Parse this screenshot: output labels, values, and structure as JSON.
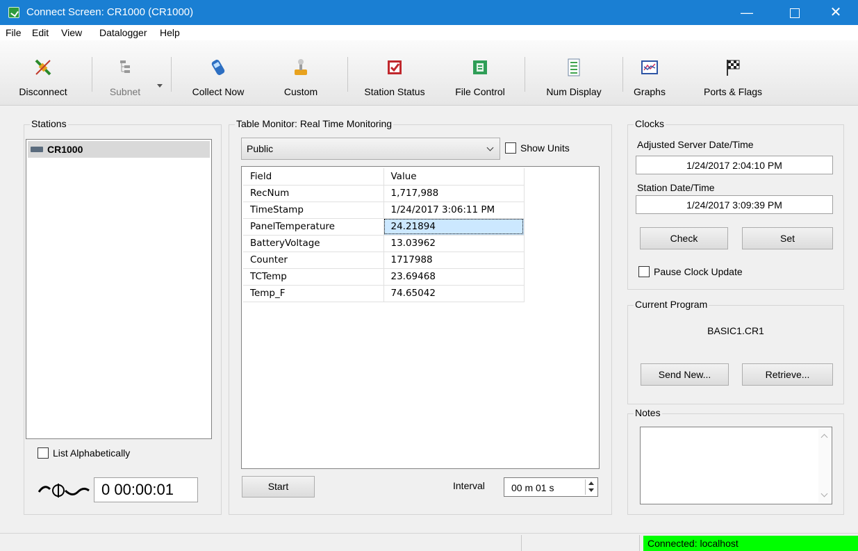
{
  "window": {
    "title": "Connect Screen: CR1000 (CR1000)",
    "minimize": "—",
    "close": "✕"
  },
  "menu": [
    "File",
    "Edit",
    "View",
    "Datalogger",
    "Help"
  ],
  "toolbar": {
    "disconnect": "Disconnect",
    "subnet": "Subnet",
    "collect_now": "Collect Now",
    "custom": "Custom",
    "station_status": "Station Status",
    "file_control": "File Control",
    "num_display": "Num Display",
    "graphs": "Graphs",
    "ports_flags": "Ports & Flags"
  },
  "stations": {
    "title": "Stations",
    "items": [
      "CR1000"
    ],
    "list_alphabetically": "List Alphabetically",
    "elapsed": "0 00:00:01"
  },
  "table_monitor": {
    "title": "Table Monitor: Real Time Monitoring",
    "table_selected": "Public",
    "show_units": "Show Units",
    "headers": [
      "Field",
      "Value"
    ],
    "rows": [
      {
        "field": "RecNum",
        "value": "1,717,988"
      },
      {
        "field": "TimeStamp",
        "value": "1/24/2017 3:06:11 PM"
      },
      {
        "field": "PanelTemperature",
        "value": "24.21894"
      },
      {
        "field": "BatteryVoltage",
        "value": "13.03962"
      },
      {
        "field": "Counter",
        "value": "1717988"
      },
      {
        "field": "TCTemp",
        "value": "23.69468"
      },
      {
        "field": "Temp_F",
        "value": "74.65042"
      }
    ],
    "start": "Start",
    "interval_label": "Interval",
    "interval_value": "00 m 01 s"
  },
  "clocks": {
    "title": "Clocks",
    "server_label": "Adjusted Server Date/Time",
    "server_value": "1/24/2017 2:04:10 PM",
    "station_label": "Station Date/Time",
    "station_value": "1/24/2017 3:09:39 PM",
    "check": "Check",
    "set": "Set",
    "pause": "Pause Clock Update"
  },
  "program": {
    "title": "Current Program",
    "name": "BASIC1.CR1",
    "send_new": "Send New...",
    "retrieve": "Retrieve..."
  },
  "notes": {
    "title": "Notes"
  },
  "status": {
    "connection": "Connected: localhost",
    "connection_color": "#00ff00"
  },
  "colors": {
    "titlebar": "#1a7fd3",
    "selected_cell": "#cce8ff"
  }
}
